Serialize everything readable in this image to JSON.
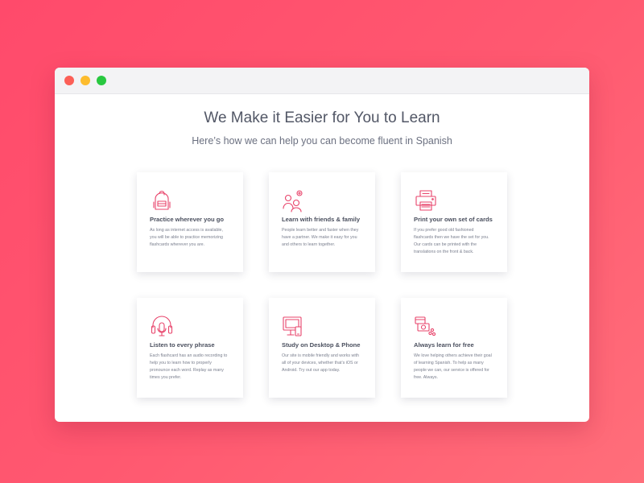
{
  "window": {
    "colors": {
      "close": "#fc5f57",
      "minimize": "#fdbc2e",
      "maximize": "#28c840"
    }
  },
  "heading": {
    "title": "We Make it Easier for You to Learn",
    "subtitle": "Here’s how we can help you can become fluent in Spanish"
  },
  "accent_color": "#e8446b",
  "features": [
    {
      "icon": "backpack-icon",
      "title": "Practice wherever you go",
      "text": "As long as internet access is available, you will be able to practice memorizing flashcards wherever you are."
    },
    {
      "icon": "people-icon",
      "title": "Learn with friends & family",
      "text": "People learn better and faster when they have a partner. We make it easy for you and others to learn together."
    },
    {
      "icon": "printer-icon",
      "title": "Print your own set of cards",
      "text": "If you prefer good old fashioned flashcards then we have the set for you. Our cards can be printed with the translations on the front & back."
    },
    {
      "icon": "headphones-icon",
      "title": "Listen to every phrase",
      "text": "Each flashcard has an audio recording to help you to learn how to properly pronounce each word. Replay as many times you prefer."
    },
    {
      "icon": "desktop-phone-icon",
      "title": "Study on Desktop & Phone",
      "text": "Our site is mobile friendly and works with all of your devices, whether that’s iOS or Android. Try out our app today."
    },
    {
      "icon": "money-icon",
      "title": "Always learn for free",
      "text": "We love helping others achieve their goal of learning Spanish. To help as many people we can, our service is offered for free. Always."
    }
  ]
}
